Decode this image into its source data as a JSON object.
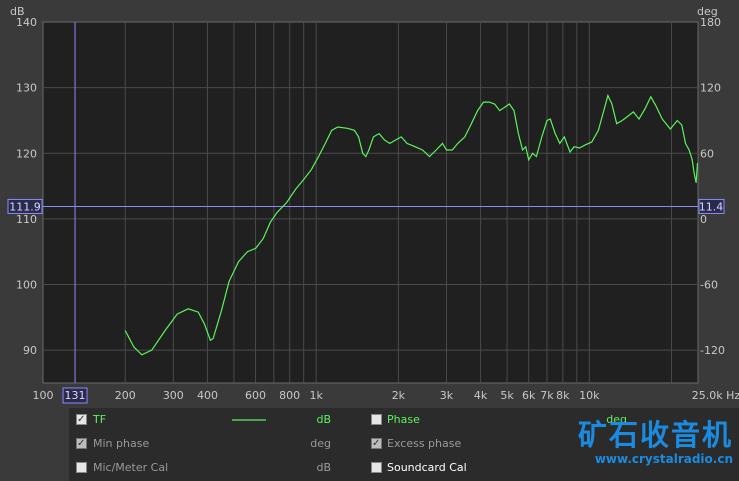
{
  "chart_data": {
    "type": "line",
    "ylabel_left": "dB",
    "ylabel_right": "deg",
    "xunit": "Hz",
    "xscale": "log",
    "xlim": [
      100,
      25000
    ],
    "ylim": [
      85,
      140
    ],
    "y2lim": [
      -150,
      180
    ],
    "grid": true,
    "yticks": [
      90,
      100,
      110,
      120,
      130,
      140
    ],
    "y2ticks": [
      -120,
      -60,
      0,
      60,
      120,
      180
    ],
    "xtick_labels": [
      {
        "v": 100,
        "t": "100"
      },
      {
        "v": 200,
        "t": "200"
      },
      {
        "v": 300,
        "t": "300"
      },
      {
        "v": 400,
        "t": "400"
      },
      {
        "v": 600,
        "t": "600"
      },
      {
        "v": 800,
        "t": "800"
      },
      {
        "v": 1000,
        "t": "1k"
      },
      {
        "v": 2000,
        "t": "2k"
      },
      {
        "v": 3000,
        "t": "3k"
      },
      {
        "v": 4000,
        "t": "4k"
      },
      {
        "v": 5000,
        "t": "5k"
      },
      {
        "v": 6000,
        "t": "6k"
      },
      {
        "v": 7000,
        "t": "7k"
      },
      {
        "v": 8000,
        "t": "8k"
      },
      {
        "v": 10000,
        "t": "10k"
      },
      {
        "v": 25000,
        "t": "25.0k Hz"
      }
    ],
    "cursor": {
      "x_label": "131",
      "x": 131,
      "y_label": "111.9",
      "y": 111.9,
      "y2_label": "11.4"
    },
    "series": [
      {
        "name": "TF",
        "color": "#5cf25c",
        "points": [
          [
            200,
            93
          ],
          [
            215,
            90.5
          ],
          [
            230,
            89.3
          ],
          [
            250,
            90
          ],
          [
            280,
            93
          ],
          [
            310,
            95.5
          ],
          [
            340,
            96.3
          ],
          [
            370,
            95.8
          ],
          [
            390,
            94
          ],
          [
            410,
            91.5
          ],
          [
            420,
            91.8
          ],
          [
            450,
            96
          ],
          [
            480,
            100.5
          ],
          [
            520,
            103.5
          ],
          [
            560,
            105
          ],
          [
            600,
            105.5
          ],
          [
            640,
            107
          ],
          [
            680,
            109.5
          ],
          [
            720,
            111
          ],
          [
            780,
            112.5
          ],
          [
            840,
            114.5
          ],
          [
            900,
            116
          ],
          [
            960,
            117.5
          ],
          [
            1020,
            119.5
          ],
          [
            1080,
            121.5
          ],
          [
            1140,
            123.5
          ],
          [
            1200,
            124
          ],
          [
            1300,
            123.8
          ],
          [
            1380,
            123.5
          ],
          [
            1430,
            122.5
          ],
          [
            1480,
            120
          ],
          [
            1520,
            119.5
          ],
          [
            1560,
            120.5
          ],
          [
            1620,
            122.5
          ],
          [
            1700,
            123
          ],
          [
            1780,
            122
          ],
          [
            1860,
            121.5
          ],
          [
            1950,
            122
          ],
          [
            2050,
            122.5
          ],
          [
            2150,
            121.5
          ],
          [
            2300,
            121
          ],
          [
            2450,
            120.5
          ],
          [
            2600,
            119.5
          ],
          [
            2750,
            120.5
          ],
          [
            2900,
            121.5
          ],
          [
            3000,
            120.5
          ],
          [
            3150,
            120.5
          ],
          [
            3300,
            121.5
          ],
          [
            3500,
            122.5
          ],
          [
            3700,
            124.5
          ],
          [
            3900,
            126.5
          ],
          [
            4100,
            127.8
          ],
          [
            4300,
            127.8
          ],
          [
            4500,
            127.5
          ],
          [
            4700,
            126.5
          ],
          [
            4900,
            127
          ],
          [
            5100,
            127.5
          ],
          [
            5300,
            126.5
          ],
          [
            5500,
            123
          ],
          [
            5700,
            120.5
          ],
          [
            5850,
            121
          ],
          [
            6000,
            119
          ],
          [
            6200,
            120
          ],
          [
            6400,
            119.5
          ],
          [
            6700,
            122.5
          ],
          [
            7000,
            125
          ],
          [
            7200,
            125.2
          ],
          [
            7500,
            123
          ],
          [
            7800,
            121.5
          ],
          [
            8100,
            122.5
          ],
          [
            8500,
            120.2
          ],
          [
            8800,
            121
          ],
          [
            9200,
            120.8
          ],
          [
            9700,
            121.3
          ],
          [
            10200,
            121.7
          ],
          [
            10800,
            123.5
          ],
          [
            11300,
            126.5
          ],
          [
            11700,
            128.8
          ],
          [
            12100,
            127.5
          ],
          [
            12600,
            124.5
          ],
          [
            13200,
            125
          ],
          [
            13800,
            125.6
          ],
          [
            14500,
            126.3
          ],
          [
            15200,
            125.2
          ],
          [
            16000,
            126.8
          ],
          [
            16800,
            128.6
          ],
          [
            17500,
            127.3
          ],
          [
            18500,
            125.2
          ],
          [
            19800,
            123.7
          ],
          [
            21000,
            125
          ],
          [
            21800,
            124.3
          ],
          [
            22500,
            121.5
          ],
          [
            23200,
            120.5
          ],
          [
            23800,
            119
          ],
          [
            24200,
            117
          ],
          [
            24600,
            115.5
          ],
          [
            24900,
            118.5
          ]
        ]
      }
    ]
  },
  "legend": {
    "rows": [
      {
        "checked": true,
        "label": "TF",
        "unit": "dB",
        "label2": "Phase",
        "unit2": "deg",
        "checked2": false
      },
      {
        "checked": true,
        "label": "Min phase",
        "unit": "deg",
        "label2": "Excess phase",
        "checked2": true
      },
      {
        "checked": false,
        "label": "Mic/Meter Cal",
        "unit": "dB",
        "label2": "Soundcard Cal",
        "checked2": false
      }
    ]
  },
  "watermark": {
    "name": "矿石收音机",
    "url": "www.crystalradio.cn"
  }
}
